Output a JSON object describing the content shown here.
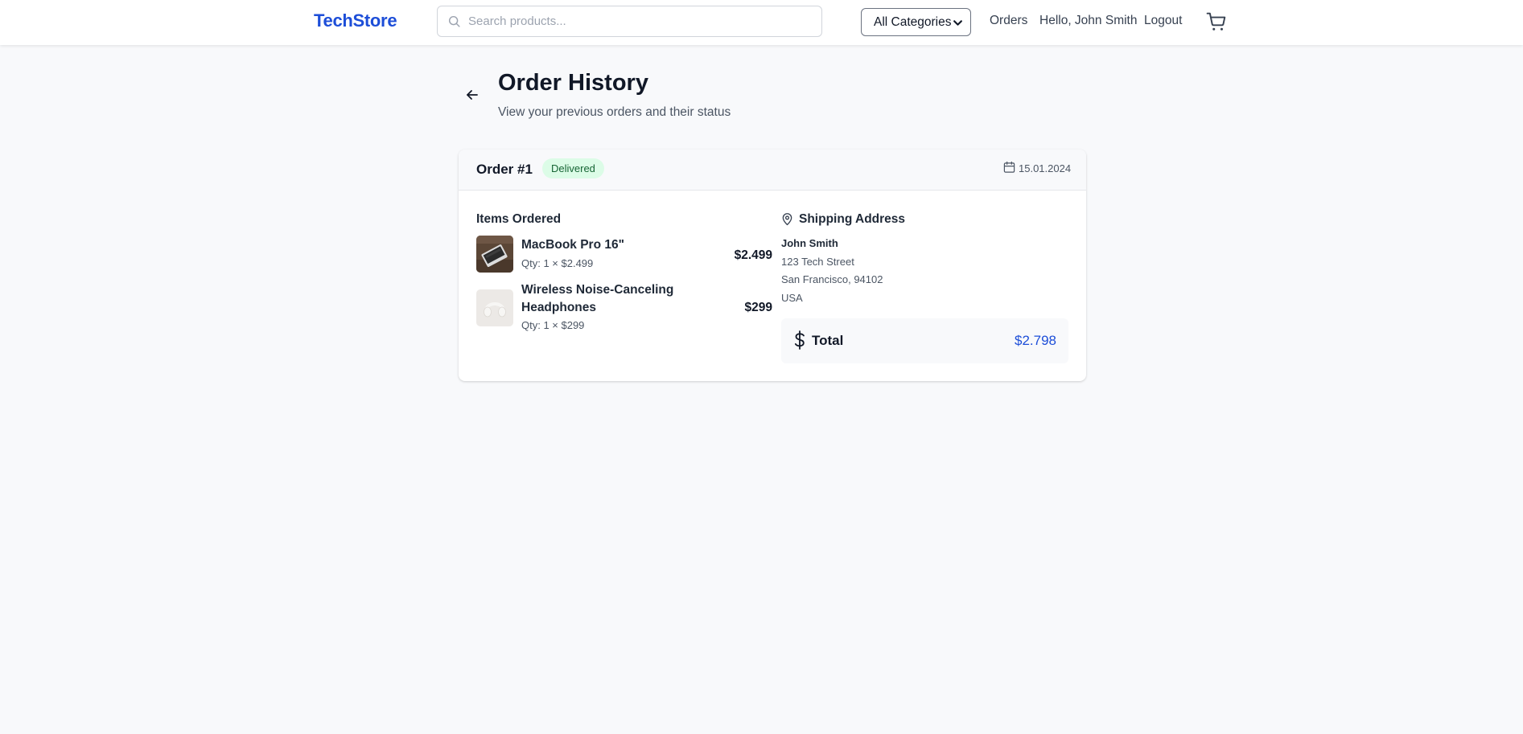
{
  "header": {
    "logo": "TechStore",
    "search_placeholder": "Search products...",
    "category_selected": "All Categories",
    "nav": {
      "orders": "Orders",
      "greeting": "Hello, John Smith",
      "logout": "Logout"
    },
    "icons": [
      "search-icon",
      "chevron-down-icon",
      "cart-icon"
    ]
  },
  "page": {
    "title": "Order History",
    "subtitle": "View your previous orders and their status"
  },
  "order": {
    "number": "Order #1",
    "status": "Delivered",
    "date": "15.01.2024",
    "items_title": "Items Ordered",
    "items": [
      {
        "name": "MacBook Pro 16\"",
        "qty": "Qty: 1 × $2.499",
        "price": "$2.499"
      },
      {
        "name": "Wireless Noise-Canceling Headphones",
        "qty": "Qty: 1 × $299",
        "price": "$299"
      }
    ],
    "shipping": {
      "title": "Shipping Address",
      "name": "John Smith",
      "street": "123 Tech Street",
      "city": "San Francisco, 94102",
      "country": "USA"
    },
    "total_label": "Total",
    "total_value": "$2.798"
  },
  "colors": {
    "brand": "#1d4ed8",
    "status_bg": "#dcfce7",
    "status_text": "#166534",
    "page_bg": "#f8f9fb"
  }
}
